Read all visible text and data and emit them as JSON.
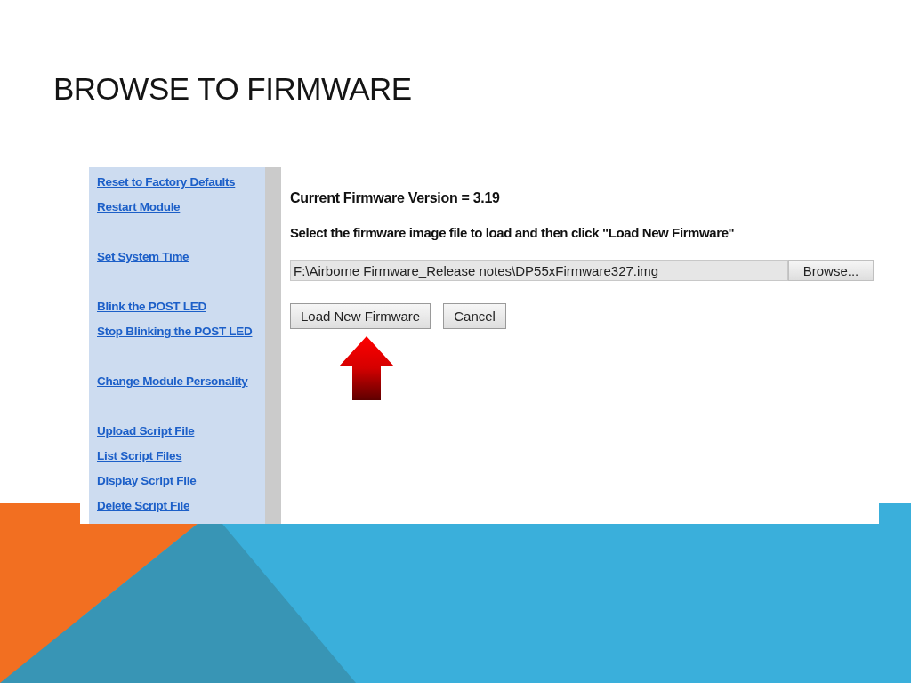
{
  "slide": {
    "title": "BROWSE TO FIRMWARE"
  },
  "sidebar": {
    "groups": [
      [
        "Reset to Factory Defaults",
        "Restart Module"
      ],
      [
        "Set System Time"
      ],
      [
        "Blink the POST LED",
        "Stop Blinking the POST LED"
      ],
      [
        "Change Module Personality"
      ],
      [
        "Upload Script File",
        "List Script Files",
        "Display Script File",
        "Delete Script File"
      ]
    ]
  },
  "content": {
    "version": "Current Firmware Version = 3.19",
    "instruction": "Select the firmware image file to load and then click \"Load New Firmware\"",
    "file_field": {
      "value": "F:\\Airborne Firmware_Release notes\\DP55xFirmware327.img",
      "button": "Browse..."
    },
    "buttons": [
      "Load New Firmware",
      "Cancel"
    ]
  }
}
